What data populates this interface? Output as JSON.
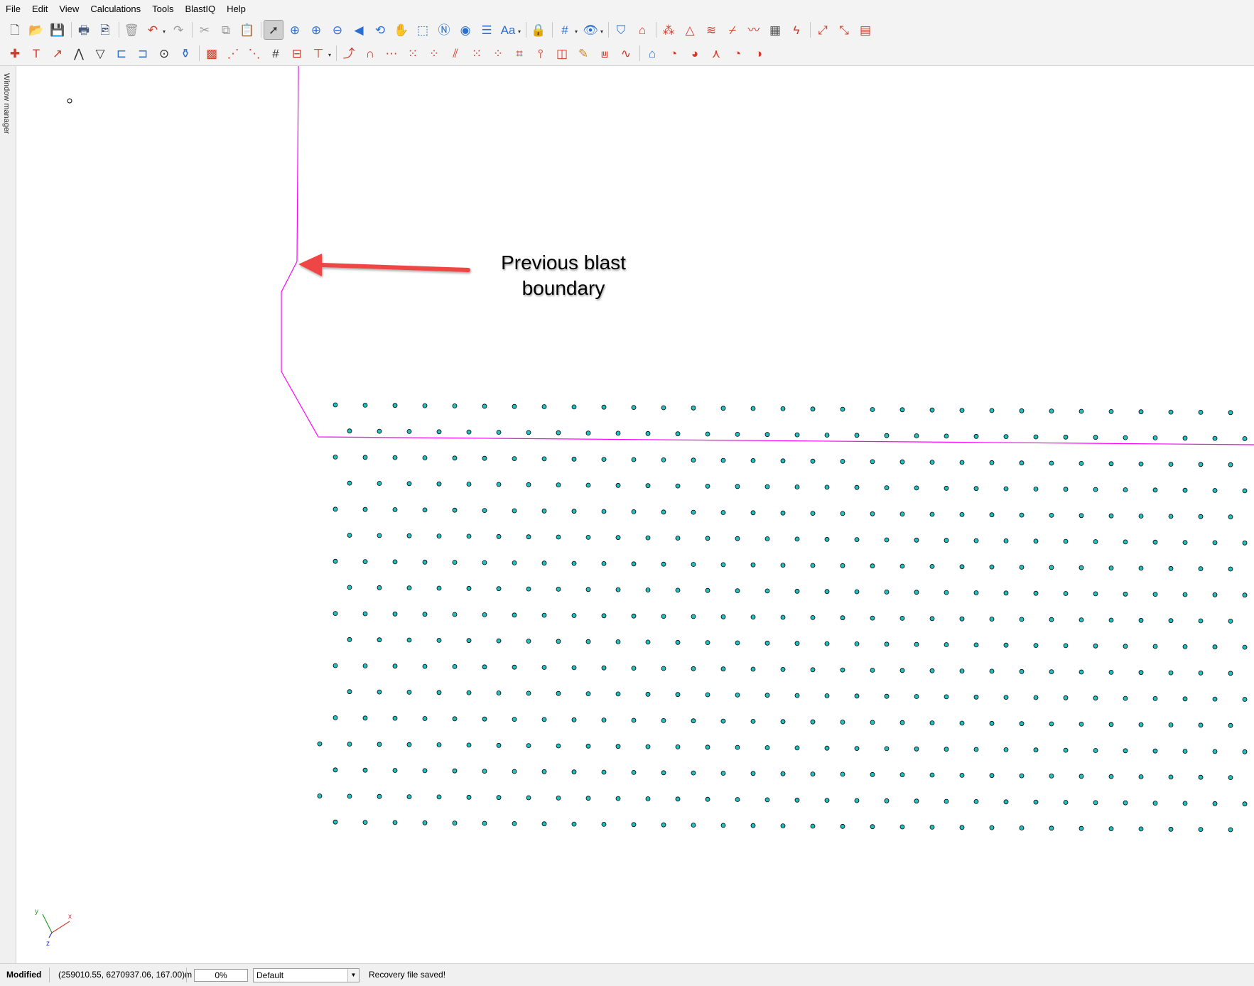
{
  "menu": [
    "File",
    "Edit",
    "View",
    "Calculations",
    "Tools",
    "BlastIQ",
    "Help"
  ],
  "toolbar1": [
    {
      "name": "new-file-icon",
      "glyph": "🗋",
      "color": "#555555"
    },
    {
      "name": "open-folder-icon",
      "glyph": "📂",
      "color": "#c79a2b"
    },
    {
      "name": "save-icon",
      "glyph": "💾",
      "color": "#3a4a6b"
    },
    {
      "sep": true
    },
    {
      "name": "print-icon",
      "glyph": "🖶",
      "color": "#4a5a7a"
    },
    {
      "name": "print-preview-icon",
      "glyph": "🖻",
      "color": "#4a5a7a"
    },
    {
      "sep": true
    },
    {
      "name": "delete-icon",
      "glyph": "🗑",
      "color": "#9a9a9a"
    },
    {
      "name": "undo-icon",
      "glyph": "↶",
      "color": "#d03a2a",
      "drop": true
    },
    {
      "name": "redo-icon",
      "glyph": "↷",
      "color": "#9a9a9a"
    },
    {
      "sep": true
    },
    {
      "name": "cut-icon",
      "glyph": "✂",
      "color": "#9a9a9a"
    },
    {
      "name": "copy-icon",
      "glyph": "⧉",
      "color": "#9a9a9a"
    },
    {
      "name": "paste-icon",
      "glyph": "📋",
      "color": "#9a9a9a"
    },
    {
      "sep": true
    },
    {
      "name": "select-pointer-icon",
      "glyph": "➚",
      "color": "#333333",
      "active": true
    },
    {
      "name": "zoom-extents-icon",
      "glyph": "⊕",
      "color": "#2a6fd0"
    },
    {
      "name": "zoom-in-icon",
      "glyph": "⊕",
      "color": "#2a6fd0"
    },
    {
      "name": "zoom-out-icon",
      "glyph": "⊖",
      "color": "#2a6fd0"
    },
    {
      "name": "zoom-previous-icon",
      "glyph": "◀",
      "color": "#2a6fd0"
    },
    {
      "name": "rotate-view-icon",
      "glyph": "⟲",
      "color": "#2a6fd0"
    },
    {
      "name": "pan-hand-icon",
      "glyph": "✋",
      "color": "#555555"
    },
    {
      "name": "zoom-window-icon",
      "glyph": "⬚",
      "color": "#2a6fd0"
    },
    {
      "name": "north-view-icon",
      "glyph": "Ⓝ",
      "color": "#2a6fd0"
    },
    {
      "name": "view-3d-icon",
      "glyph": "◉",
      "color": "#2a6fd0"
    },
    {
      "name": "layers-icon",
      "glyph": "☰",
      "color": "#2a6fd0"
    },
    {
      "name": "text-size-icon",
      "glyph": "Aa",
      "color": "#2a6fd0",
      "drop": true
    },
    {
      "sep": true
    },
    {
      "name": "lock-icon",
      "glyph": "🔒",
      "color": "#c98a2b"
    },
    {
      "sep": true
    },
    {
      "name": "snap-grid-icon",
      "glyph": "#",
      "color": "#2a6fd0",
      "drop": true
    },
    {
      "name": "visibility-grid-icon",
      "glyph": "👁",
      "color": "#2a6fd0",
      "drop": true
    },
    {
      "sep": true
    },
    {
      "name": "surface-icon",
      "glyph": "⛉",
      "color": "#2a6fd0"
    },
    {
      "name": "contour-icon",
      "glyph": "⌂",
      "color": "#d03a2a"
    },
    {
      "sep": true
    },
    {
      "name": "burden-spacing-icon",
      "glyph": "⁂",
      "color": "#d03a2a"
    },
    {
      "name": "triangle-icon",
      "glyph": "△",
      "color": "#d03a2a"
    },
    {
      "name": "flag-icon",
      "glyph": "≋",
      "color": "#d03a2a"
    },
    {
      "name": "section-icon",
      "glyph": "⌿",
      "color": "#d03a2a"
    },
    {
      "name": "graph-icon",
      "glyph": "〰",
      "color": "#d03a2a"
    },
    {
      "name": "calculator-icon",
      "glyph": "▦",
      "color": "#555555"
    },
    {
      "name": "firing-icon",
      "glyph": "ϟ",
      "color": "#d03a2a"
    },
    {
      "sep": true
    },
    {
      "name": "tie-up-icon",
      "glyph": "⤢",
      "color": "#d03a2a"
    },
    {
      "name": "connect-icon",
      "glyph": "⤡",
      "color": "#d03a2a"
    },
    {
      "name": "table-icon",
      "glyph": "▤",
      "color": "#d03a2a"
    }
  ],
  "toolbar2": [
    {
      "name": "add-point-icon",
      "glyph": "✚",
      "color": "#d03a2a"
    },
    {
      "name": "text-tool-icon",
      "glyph": "T",
      "color": "#d03a2a"
    },
    {
      "name": "arrow-tool-icon",
      "glyph": "↗",
      "color": "#d03a2a"
    },
    {
      "name": "polyline-icon",
      "glyph": "⋀",
      "color": "#333333"
    },
    {
      "name": "polygon-icon",
      "glyph": "▽",
      "color": "#333333"
    },
    {
      "name": "dimension-icon",
      "glyph": "⊏",
      "color": "#2a6fd0"
    },
    {
      "name": "dimension-123-icon",
      "glyph": "⊐",
      "color": "#2a6fd0"
    },
    {
      "name": "circle-icon",
      "glyph": "⊙",
      "color": "#333333"
    },
    {
      "name": "bottle-icon",
      "glyph": "⚱",
      "color": "#2a6fd0"
    },
    {
      "sep": true
    },
    {
      "name": "pattern-100-icon",
      "glyph": "▩",
      "color": "#d03a2a"
    },
    {
      "name": "line-hole-icon",
      "glyph": "⋰",
      "color": "#d03a2a"
    },
    {
      "name": "line-hole-2-icon",
      "glyph": "⋱",
      "color": "#d03a2a"
    },
    {
      "name": "numbering-icon",
      "glyph": "#",
      "color": "#333333"
    },
    {
      "name": "hole-design-icon",
      "glyph": "⊟",
      "color": "#d03a2a"
    },
    {
      "name": "drill-icon",
      "glyph": "⊤",
      "color": "#d03a2a",
      "drop": true
    },
    {
      "sep": true
    },
    {
      "name": "timing-icon",
      "glyph": "⤴",
      "color": "#d03a2a"
    },
    {
      "name": "arch-icon",
      "glyph": "∩",
      "color": "#d03a2a"
    },
    {
      "name": "row-icon",
      "glyph": "⋯",
      "color": "#d03a2a"
    },
    {
      "name": "grid-holes-icon",
      "glyph": "⁙",
      "color": "#d03a2a"
    },
    {
      "name": "grid-holes-2-icon",
      "glyph": "⁘",
      "color": "#d03a2a"
    },
    {
      "name": "echelon-icon",
      "glyph": "⫽",
      "color": "#d03a2a"
    },
    {
      "name": "grid-holes-3-icon",
      "glyph": "⁙",
      "color": "#d03a2a"
    },
    {
      "name": "grid-holes-4-icon",
      "glyph": "⁘",
      "color": "#d03a2a"
    },
    {
      "name": "frame-icon",
      "glyph": "⌗",
      "color": "#d03a2a"
    },
    {
      "name": "post-icon",
      "glyph": "⫯",
      "color": "#d03a2a"
    },
    {
      "name": "cube-icon",
      "glyph": "◫",
      "color": "#d03a2a"
    },
    {
      "name": "paint-icon",
      "glyph": "✎",
      "color": "#c98a2b"
    },
    {
      "name": "profile-icon",
      "glyph": "⩏",
      "color": "#d03a2a"
    },
    {
      "name": "wave-icon",
      "glyph": "∿",
      "color": "#d03a2a"
    },
    {
      "sep": true
    },
    {
      "name": "home-view-icon",
      "glyph": "⌂",
      "color": "#2a6fd0"
    },
    {
      "name": "timing-delay-icon",
      "glyph": "◔",
      "color": "#d03a2a"
    },
    {
      "name": "timing-delay-2-icon",
      "glyph": "◕",
      "color": "#d03a2a"
    },
    {
      "name": "timing-delay-3-icon",
      "glyph": "⋏",
      "color": "#d03a2a"
    },
    {
      "name": "timing-delay-4-icon",
      "glyph": "◔",
      "color": "#d03a2a"
    },
    {
      "name": "timing-delay-5-icon",
      "glyph": "◑",
      "color": "#d03a2a"
    }
  ],
  "side_panel_label": "Window manager",
  "annotation": {
    "line1": "Previous blast",
    "line2": "boundary"
  },
  "axis": {
    "x": "x",
    "y": "y",
    "z": "z"
  },
  "colors": {
    "boundary": "#ff00ff",
    "hole_fill": "#20c0c0",
    "hole_stroke": "#000000",
    "arrow": "#f04545"
  },
  "status": {
    "modified": "Modified",
    "coords": "(259010.55, 6270937.06, 167.00)m",
    "progress": "0%",
    "layer": "Default",
    "message": "Recovery file saved!"
  }
}
